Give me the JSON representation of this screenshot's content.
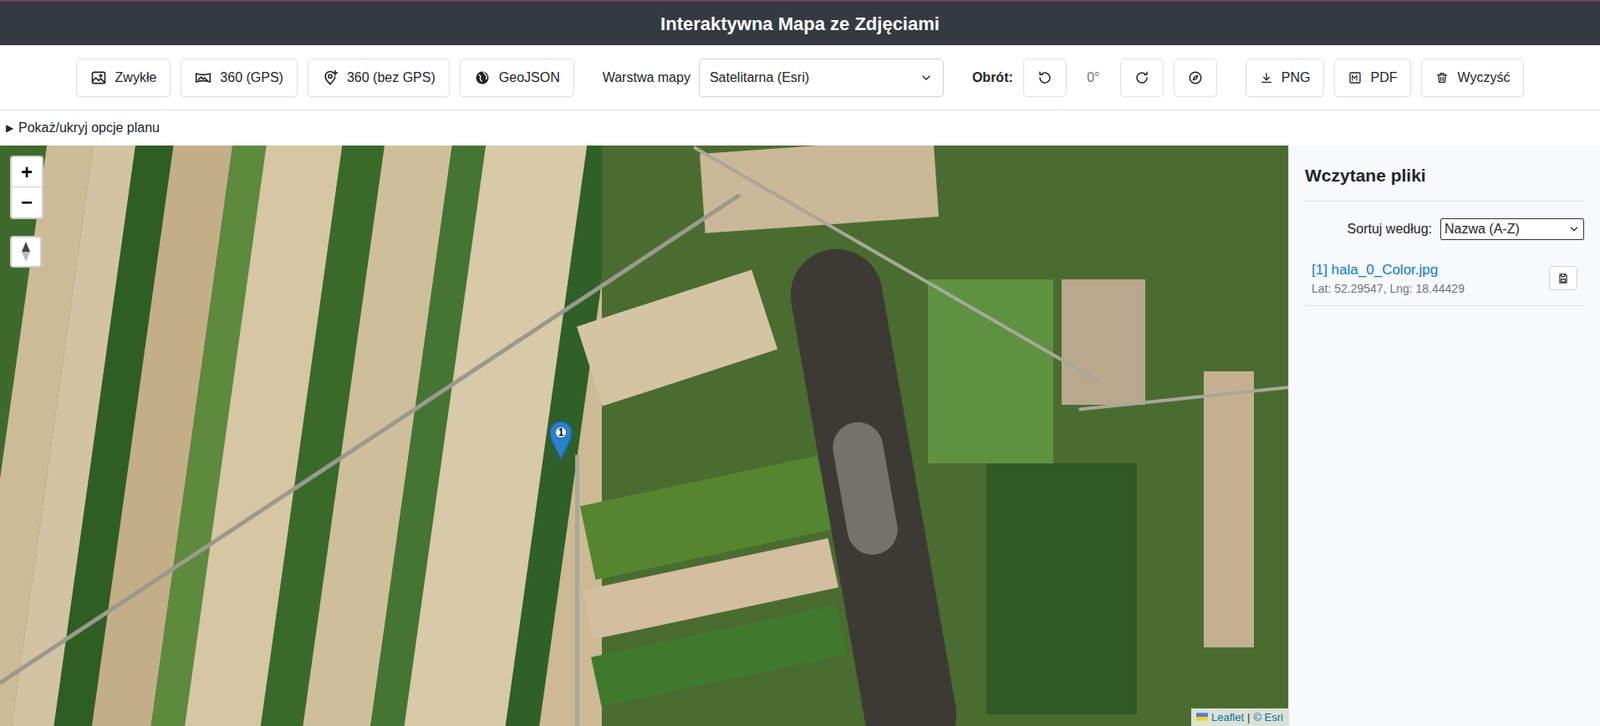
{
  "header": {
    "title": "Interaktywna Mapa ze Zdjęciami"
  },
  "toolbar": {
    "upload_buttons": [
      "Zwykłe",
      "360 (GPS)",
      "360 (bez GPS)",
      "GeoJSON"
    ],
    "layer_label": "Warstwa mapy",
    "layer_value": "Satelitarna (Esri)",
    "rotation_label": "Obrót:",
    "rotation_value": "0°",
    "export_buttons": [
      "PNG",
      "PDF",
      "Wyczyść"
    ]
  },
  "plan_toggle": {
    "icon": "▶",
    "label": "Pokaż/ukryj opcje planu",
    "expanded": false
  },
  "map": {
    "zoom_in": "+",
    "zoom_out": "−",
    "markers": [
      {
        "label": "1"
      }
    ],
    "attribution": {
      "leaflet": "Leaflet",
      "separator": "|",
      "esri": "© Esri"
    }
  },
  "sidebar": {
    "title": "Wczytane pliki",
    "sort_label": "Sortuj według:",
    "sort_value": "Nazwa (A-Z)",
    "files": [
      {
        "name": "[1] hala_0_Color.jpg",
        "coords": "Lat: 52.29547, Lng: 18.44429"
      }
    ]
  }
}
